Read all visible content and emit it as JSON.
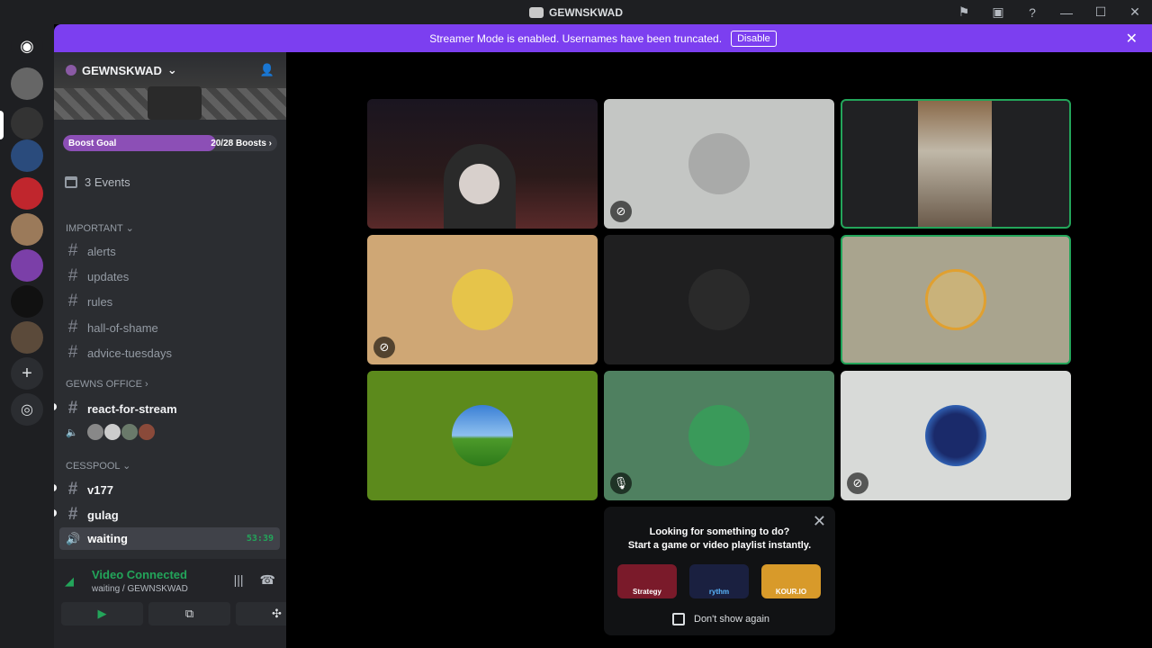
{
  "window": {
    "title": "GEWNSKWAD"
  },
  "banner": {
    "text": "Streamer Mode is enabled. Usernames have been truncated.",
    "button": "Disable"
  },
  "server": {
    "name": "GEWNSKWAD",
    "boost_label": "Boost Goal",
    "boost_count": "20/28 Boosts",
    "boost_progress": 0.714,
    "events": "3 Events"
  },
  "categories": [
    {
      "name": "IMPORTANT",
      "channels": [
        "alerts",
        "updates",
        "rules",
        "hall-of-shame",
        "advice-tuesdays"
      ]
    },
    {
      "name": "GEWNS OFFICE",
      "channels": [
        "react-for-stream"
      ]
    },
    {
      "name": "CESSPOOL",
      "channels": [
        "v177",
        "gulag"
      ]
    }
  ],
  "active_channel": {
    "name": "waiting",
    "timer": "53:39"
  },
  "voice": {
    "status": "Video Connected",
    "location": "waiting / GEWNSKWAD"
  },
  "activity": {
    "line1": "Looking for something to do?",
    "line2": "Start a game or video playlist instantly.",
    "apps": [
      "Strategy",
      "rythm",
      "KOUR.IO"
    ],
    "dont_show": "Don't show again"
  },
  "colors": {
    "accent": "#7c3ff0",
    "speaking": "#23a55a",
    "sidebar": "#2b2d31"
  }
}
